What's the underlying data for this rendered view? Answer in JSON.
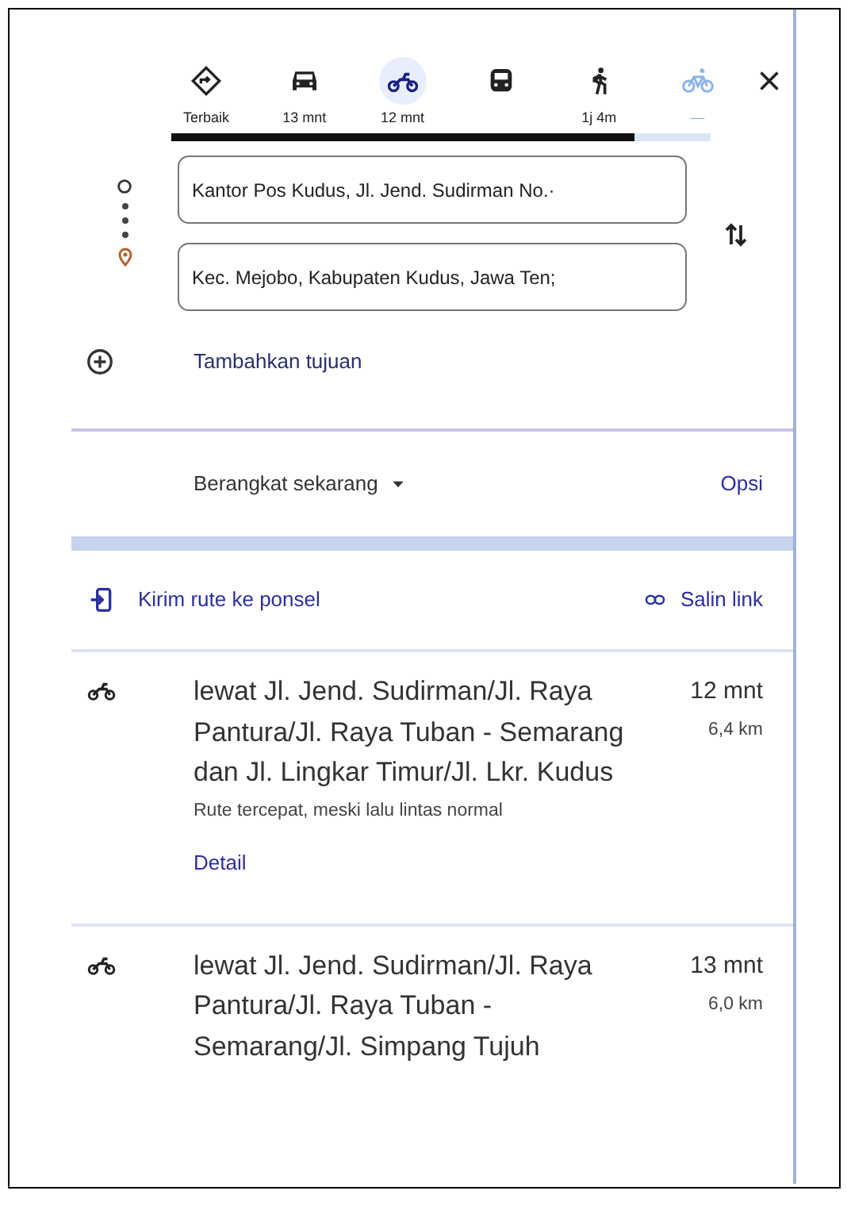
{
  "travel_modes": [
    {
      "kind": "best",
      "label": "Terbaik",
      "selected": false,
      "disabled": false
    },
    {
      "kind": "car",
      "label": "13 mnt",
      "selected": false,
      "disabled": false
    },
    {
      "kind": "motorcycle",
      "label": "12 mnt",
      "selected": true,
      "disabled": false
    },
    {
      "kind": "transit",
      "selected": false,
      "disabled": false
    },
    {
      "kind": "walk",
      "label": "1j 4m",
      "selected": false,
      "disabled": false
    },
    {
      "kind": "bike",
      "label": "—",
      "selected": false,
      "disabled": true
    }
  ],
  "loading_bar": {
    "level": 0.86
  },
  "origin": {
    "value": "Kantor Pos Kudus, Jl. Jend. Sudirman No.·"
  },
  "destination": {
    "value": "Kec. Mejobo, Kabupaten Kudus, Jawa Ten;"
  },
  "add_destination": "Tambahkan tujuan",
  "departure": {
    "label": "Berangkat sekarang",
    "options_link": "Opsi"
  },
  "actions": {
    "send": "Kirim rute ke ponsel",
    "copy": "Salin link"
  },
  "routes": [
    {
      "title": "lewat Jl. Jend. Sudirman/Jl. Raya Pantura/Jl. Raya Tuban - Semarang dan Jl. Lingkar Timur/Jl. Lkr. Kudus",
      "duration": "12 mnt",
      "distance": "6,4 km",
      "note": "Rute tercepat, meski lalu lintas normal",
      "details_link": "Detail"
    },
    {
      "title": "lewat Jl. Jend. Sudirman/Jl. Raya Pantura/Jl. Raya Tuban - Semarang/Jl. Simpang Tujuh",
      "duration": "13 mnt",
      "distance": "6,0 km"
    }
  ]
}
